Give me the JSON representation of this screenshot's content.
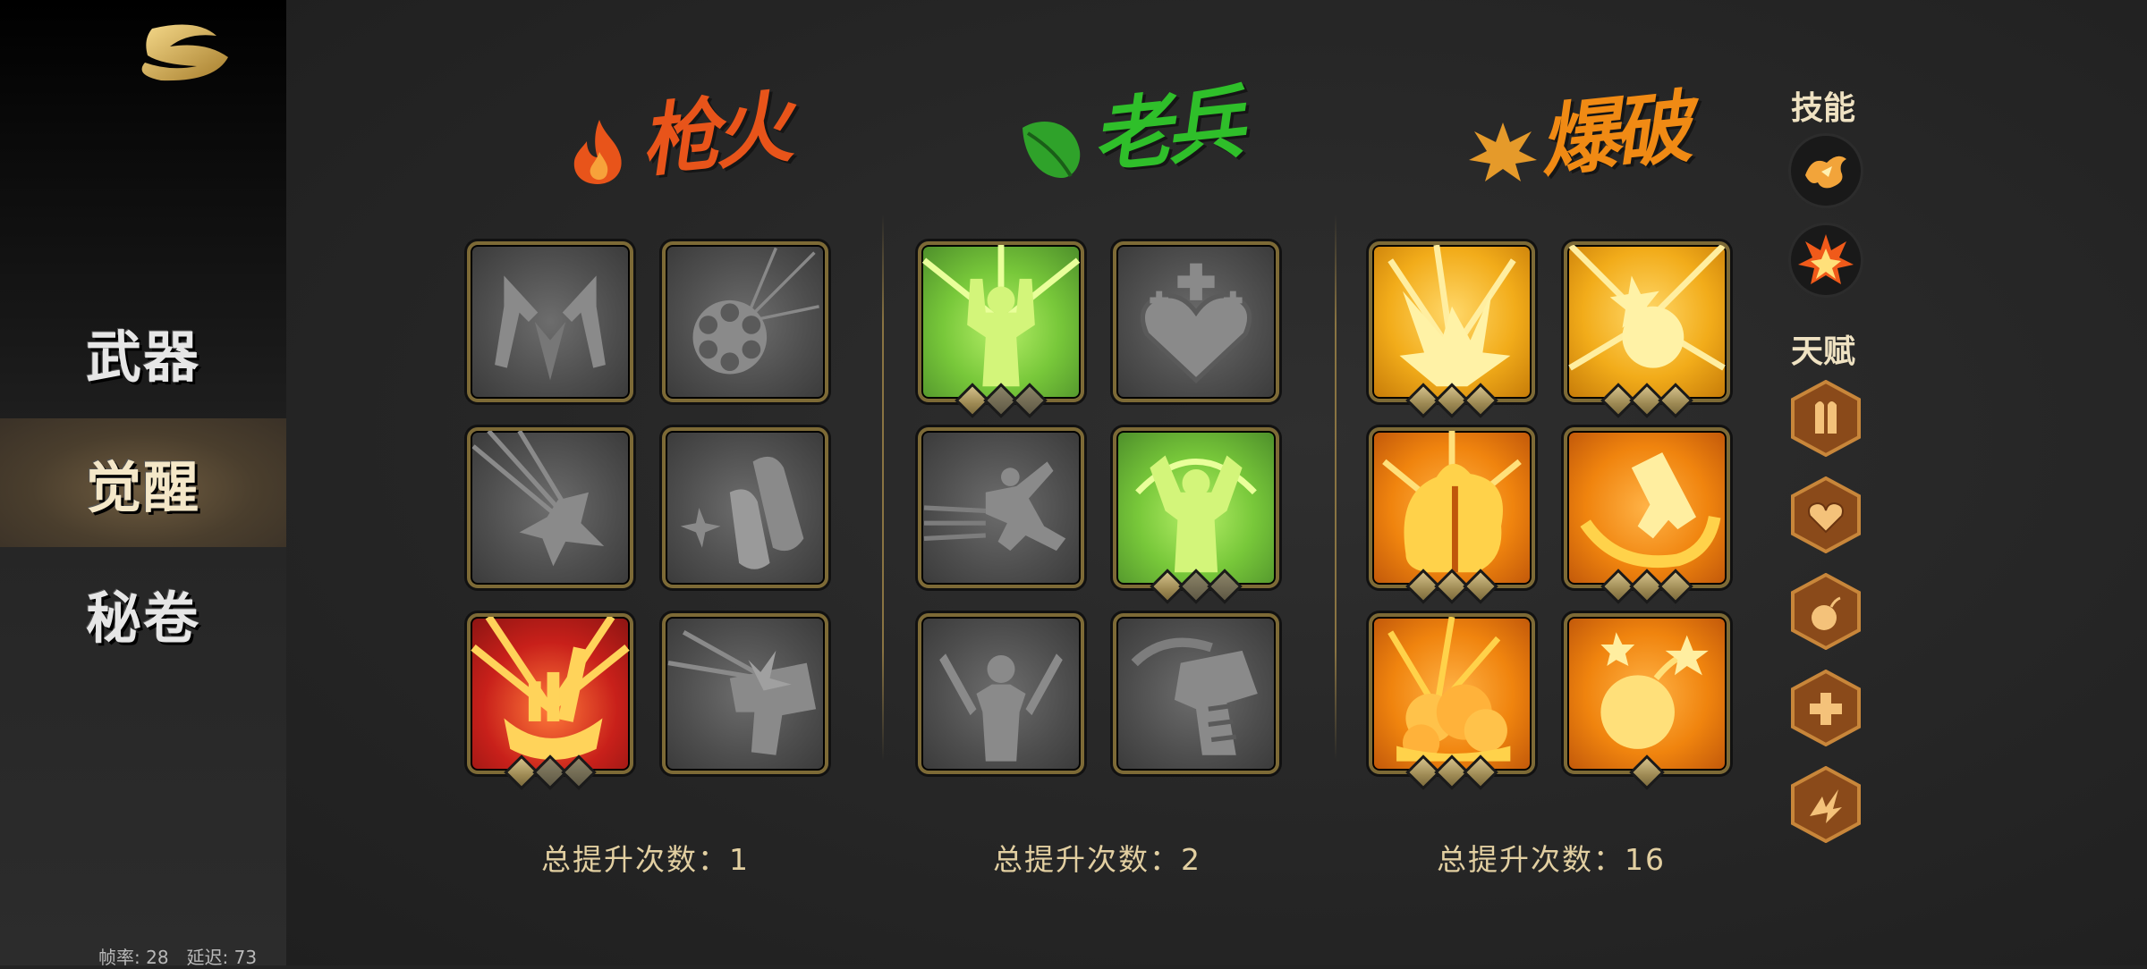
{
  "sidebar": {
    "nav": [
      {
        "label": "武器",
        "active": false
      },
      {
        "label": "觉醒",
        "active": true
      },
      {
        "label": "秘卷",
        "active": false
      }
    ],
    "stats": "帧率: 28　延迟: 73"
  },
  "columns": [
    {
      "title": "枪火",
      "title_color": "#e8541a",
      "emblem": "flame-icon",
      "total": "总提升次数：1",
      "tiles": [
        {
          "icon": "dual-pistols-icon",
          "style": "gray",
          "diamonds": 0
        },
        {
          "icon": "revolver-cylinder-icon",
          "style": "gray",
          "diamonds": 0
        },
        {
          "icon": "bullet-impact-icon",
          "style": "gray",
          "diamonds": 0
        },
        {
          "icon": "bullet-shells-icon",
          "style": "gray",
          "diamonds": 0
        },
        {
          "icon": "ammo-stack-icon",
          "style": "red",
          "diamonds": 3
        },
        {
          "icon": "pistol-blast-icon",
          "style": "gray",
          "diamonds": 0
        }
      ]
    },
    {
      "title": "老兵",
      "title_color": "#2fbf2a",
      "emblem": "leaf-icon",
      "total": "总提升次数：2",
      "tiles": [
        {
          "icon": "soldier-flex-icon",
          "style": "green",
          "diamonds": 3
        },
        {
          "icon": "heart-shield-icon",
          "style": "gray",
          "diamonds": 0
        },
        {
          "icon": "dash-soldier-icon",
          "style": "gray",
          "diamonds": 0
        },
        {
          "icon": "rocket-soldier-icon",
          "style": "green",
          "diamonds": 3
        },
        {
          "icon": "dual-blade-soldier-icon",
          "style": "gray",
          "diamonds": 0
        },
        {
          "icon": "heavy-gun-icon",
          "style": "gray",
          "diamonds": 0
        }
      ]
    },
    {
      "title": "爆破",
      "title_color": "#f08a14",
      "emblem": "explosion-icon",
      "total": "总提升次数：16",
      "tiles": [
        {
          "icon": "lightning-blast-icon",
          "style": "gold",
          "diamonds": 3
        },
        {
          "icon": "grenade-burst-icon",
          "style": "gold",
          "diamonds": 3
        },
        {
          "icon": "flame-head-icon",
          "style": "orange",
          "diamonds": 3
        },
        {
          "icon": "gun-swirl-icon",
          "style": "orange",
          "diamonds": 3
        },
        {
          "icon": "explosion-cloud-icon",
          "style": "orange",
          "diamonds": 3
        },
        {
          "icon": "bomb-icon",
          "style": "orange",
          "diamonds": 1
        }
      ]
    }
  ],
  "right_panel": {
    "skills_heading": "技能",
    "skills": [
      {
        "icon": "fire-bird-icon"
      },
      {
        "icon": "explosion-icon"
      }
    ],
    "talents_heading": "天赋",
    "talents": [
      {
        "icon": "bullets-icon"
      },
      {
        "icon": "heart-icon"
      },
      {
        "icon": "bomb-icon"
      },
      {
        "icon": "medkit-icon"
      },
      {
        "icon": "lightning-icon"
      }
    ]
  },
  "colors": {
    "gold_border": "#7d6a36",
    "total_text": "#e2cfa1",
    "diamond": "#b8a66e"
  }
}
